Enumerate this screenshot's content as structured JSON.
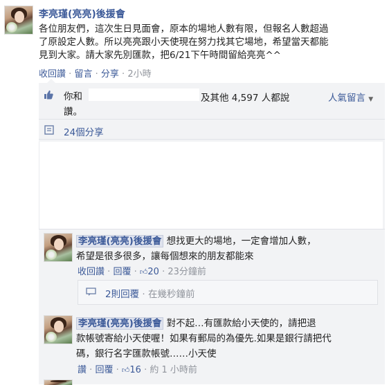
{
  "post": {
    "author": "李亮瑾(亮亮)後援會",
    "lines": [
      "各位朋友們，這次生日見面會，原本的場地人數有限，但報名人數超過",
      "了原設定人數。所以亮亮跟小天使現在努力找其它場地，希望當天都能",
      "見到大家。請大家先別匯款，把6/21下午時間留給亮亮^^"
    ],
    "actions": {
      "unlike": "收回讚",
      "comment": "留言",
      "share": "分享",
      "time": "2小時",
      "sep": "·"
    }
  },
  "likes": {
    "you_and": "你和",
    "others": "及其他 4,597 人都說",
    "like_word": "讚。",
    "top_comments": "人氣留言"
  },
  "shares": {
    "label": "24個分享"
  },
  "comments": [
    {
      "author": "李亮瑾(亮亮)後援會",
      "text1": "想找更大的場地，一定會增加人數，",
      "text2": "希望是很多很多，讓每個想來的朋友都能來",
      "unlike": "收回讚",
      "reply": "回覆",
      "likes": "20",
      "time": "23分鐘前",
      "replies": {
        "label": "2則回覆",
        "time": "在幾秒鐘前"
      }
    },
    {
      "author": "李亮瑾(亮亮)後援會",
      "text1": "對不起…有匯款給小天使的，請把退",
      "text2": "款帳號寄給小天使喔！如果有郵局的為優先.如果是銀行請把代",
      "text3": "碼，銀行名字匯款帳號……小天使",
      "like": "讚",
      "reply": "回覆",
      "likes": "16",
      "time": "約 1 小時前"
    }
  ]
}
